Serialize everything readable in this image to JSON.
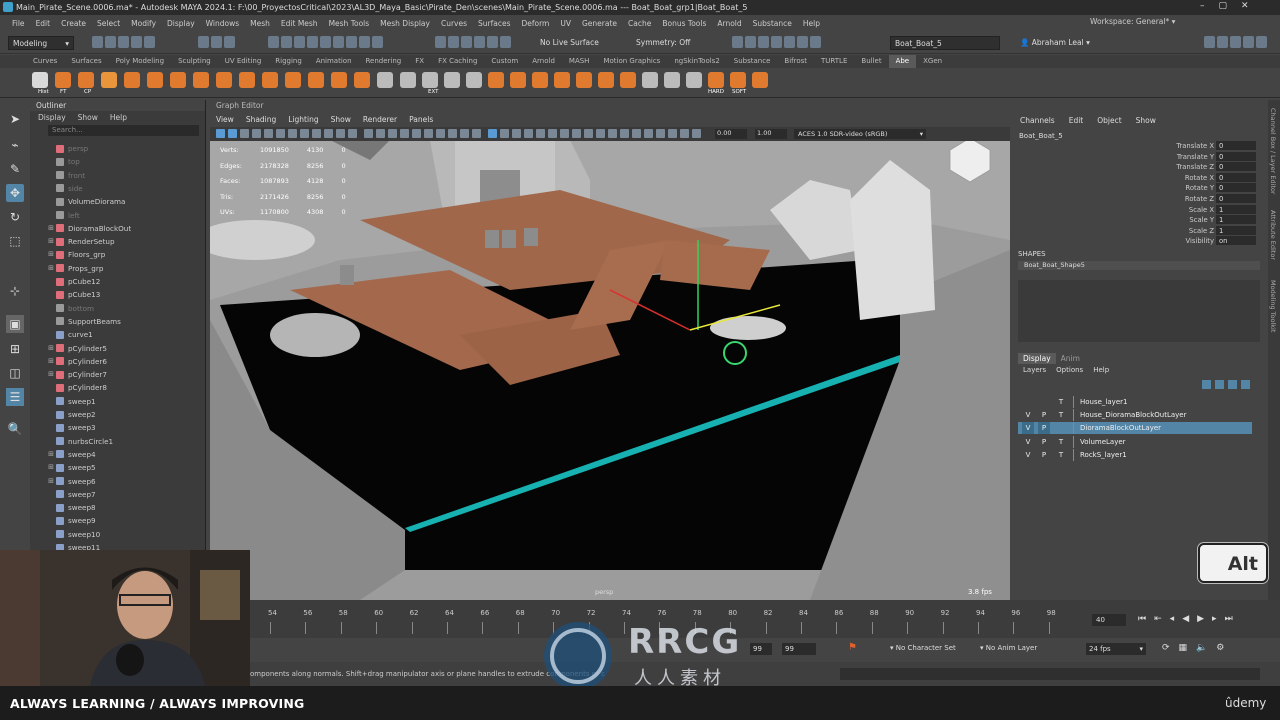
{
  "window": {
    "title": "Main_Pirate_Scene.0006.ma* - Autodesk MAYA 2024.1: F:\\00_ProyectosCritical\\2023\\AL3D_Maya_Basic\\Pirate_Den\\scenes\\Main_Pirate_Scene.0006.ma   ---   Boat_Boat_grp1|Boat_Boat_5"
  },
  "menu": [
    "File",
    "Edit",
    "Create",
    "Select",
    "Modify",
    "Display",
    "Windows",
    "Mesh",
    "Edit Mesh",
    "Mesh Tools",
    "Mesh Display",
    "Curves",
    "Surfaces",
    "Deform",
    "UV",
    "Generate",
    "Cache",
    "Bonus Tools",
    "Arnold",
    "Substance",
    "Help"
  ],
  "workspace": {
    "label": "Workspace:",
    "value": "General*"
  },
  "status": {
    "mode": "Modeling",
    "live_surface": "No Live Surface",
    "symmetry": "Symmetry: Off",
    "object_field": "Boat_Boat_5",
    "user": "Abraham Leal"
  },
  "shelf_tabs": [
    "Curves",
    "Surfaces",
    "Poly Modeling",
    "Sculpting",
    "UV Editing",
    "Rigging",
    "Animation",
    "Rendering",
    "FX",
    "FX Caching",
    "Custom",
    "Arnold",
    "MASH",
    "Motion Graphics",
    "ngSkinTools2",
    "Substance",
    "Bifrost",
    "TURTLE",
    "Bullet",
    "Abe",
    "XGen"
  ],
  "shelf_labels": {
    "hist": "Hist",
    "ft": "FT",
    "cp": "CP",
    "ext": "EXT",
    "hard": "HARD",
    "soft": "SOFT"
  },
  "outliner": {
    "title": "Outliner",
    "menu": [
      "Display",
      "Show",
      "Help"
    ],
    "search_placeholder": "Search...",
    "items": [
      {
        "name": "persp",
        "dim": true,
        "exp": ""
      },
      {
        "name": "top",
        "dim": true,
        "exp": ""
      },
      {
        "name": "front",
        "dim": true,
        "exp": ""
      },
      {
        "name": "side",
        "dim": true,
        "exp": ""
      },
      {
        "name": "VolumeDiorama",
        "dim": false,
        "exp": ""
      },
      {
        "name": "left",
        "dim": true,
        "exp": ""
      },
      {
        "name": "DioramaBlockOut",
        "dim": false,
        "exp": "+"
      },
      {
        "name": "RenderSetup",
        "dim": false,
        "exp": "+"
      },
      {
        "name": "Floors_grp",
        "dim": false,
        "exp": "+"
      },
      {
        "name": "Props_grp",
        "dim": false,
        "exp": "+"
      },
      {
        "name": "pCube12",
        "dim": false,
        "exp": ""
      },
      {
        "name": "pCube13",
        "dim": false,
        "exp": ""
      },
      {
        "name": "bottom",
        "dim": true,
        "exp": ""
      },
      {
        "name": "SupportBeams",
        "dim": false,
        "exp": ""
      },
      {
        "name": "curve1",
        "dim": false,
        "exp": ""
      },
      {
        "name": "pCylinder5",
        "dim": false,
        "exp": "+"
      },
      {
        "name": "pCylinder6",
        "dim": false,
        "exp": "+"
      },
      {
        "name": "pCylinder7",
        "dim": false,
        "exp": "+"
      },
      {
        "name": "pCylinder8",
        "dim": false,
        "exp": ""
      },
      {
        "name": "sweep1",
        "dim": false,
        "exp": ""
      },
      {
        "name": "sweep2",
        "dim": false,
        "exp": ""
      },
      {
        "name": "sweep3",
        "dim": false,
        "exp": ""
      },
      {
        "name": "nurbsCircle1",
        "dim": false,
        "exp": ""
      },
      {
        "name": "sweep4",
        "dim": false,
        "exp": "+"
      },
      {
        "name": "sweep5",
        "dim": false,
        "exp": "+"
      },
      {
        "name": "sweep6",
        "dim": false,
        "exp": "+"
      },
      {
        "name": "sweep7",
        "dim": false,
        "exp": ""
      },
      {
        "name": "sweep8",
        "dim": false,
        "exp": ""
      },
      {
        "name": "sweep9",
        "dim": false,
        "exp": ""
      },
      {
        "name": "sweep10",
        "dim": false,
        "exp": ""
      },
      {
        "name": "sweep11",
        "dim": false,
        "exp": ""
      }
    ]
  },
  "viewport": {
    "panel_title": "Graph Editor",
    "menu": [
      "View",
      "Shading",
      "Lighting",
      "Show",
      "Renderer",
      "Panels"
    ],
    "field1": "0.00",
    "field2": "1.00",
    "colorspace": "ACES 1.0 SDR-video (sRGB)",
    "camera": "persp",
    "fps": "3.8 fps",
    "stats": [
      {
        "label": "Verts:",
        "a": "1091850",
        "b": "4130",
        "c": "0"
      },
      {
        "label": "Edges:",
        "a": "2178328",
        "b": "8256",
        "c": "0"
      },
      {
        "label": "Faces:",
        "a": "1087893",
        "b": "4128",
        "c": "0"
      },
      {
        "label": "Tris:",
        "a": "2171426",
        "b": "8256",
        "c": "0"
      },
      {
        "label": "UVs:",
        "a": "1170800",
        "b": "4308",
        "c": "0"
      }
    ]
  },
  "channel_box": {
    "menu": [
      "Channels",
      "Edit",
      "Object",
      "Show"
    ],
    "object": "Boat_Boat_5",
    "attrs": [
      {
        "n": "Translate X",
        "v": "0"
      },
      {
        "n": "Translate Y",
        "v": "0"
      },
      {
        "n": "Translate Z",
        "v": "0"
      },
      {
        "n": "Rotate X",
        "v": "0"
      },
      {
        "n": "Rotate Y",
        "v": "0"
      },
      {
        "n": "Rotate Z",
        "v": "0"
      },
      {
        "n": "Scale X",
        "v": "1"
      },
      {
        "n": "Scale Y",
        "v": "1"
      },
      {
        "n": "Scale Z",
        "v": "1"
      },
      {
        "n": "Visibility",
        "v": "on"
      }
    ],
    "shapes_label": "SHAPES",
    "shape": "Boat_Boat_Shape5"
  },
  "layers": {
    "tabs": [
      "Display",
      "Anim"
    ],
    "menu": [
      "Layers",
      "Options",
      "Help"
    ],
    "items": [
      {
        "v": "",
        "p": "",
        "t": "T",
        "name": "House_layer1",
        "sel": false
      },
      {
        "v": "V",
        "p": "P",
        "t": "T",
        "name": "House_DioramaBlockOutLayer",
        "sel": false
      },
      {
        "v": "V",
        "p": "P",
        "t": "",
        "name": "DioramaBlockOutLayer",
        "sel": true
      },
      {
        "v": "V",
        "p": "P",
        "t": "T",
        "name": "VolumeLayer",
        "sel": false
      },
      {
        "v": "V",
        "p": "P",
        "t": "T",
        "name": "RockS_layer1",
        "sel": false
      }
    ]
  },
  "side_tabs": [
    "Channel Box / Layer Editor",
    "Attribute Editor",
    "Modeling Toolkit"
  ],
  "timeline": {
    "ticks": [
      "54",
      "56",
      "58",
      "60",
      "62",
      "64",
      "66",
      "68",
      "70",
      "72",
      "74",
      "76",
      "78",
      "80",
      "82",
      "84",
      "86",
      "88",
      "90",
      "92",
      "94",
      "96",
      "98"
    ],
    "current": "40",
    "range_a": "99",
    "range_b": "99",
    "char_set": "No Character Set",
    "anim_layer": "No Anim Layer",
    "fps": "24 fps"
  },
  "help_line": "omponents along normals. Shift+drag manipulator axis or plane handles to extrude components or c",
  "overlay": {
    "alt_key": "Alt",
    "slogan": "ALWAYS LEARNING  / ALWAYS IMPROVING",
    "watermark": "RRCG",
    "watermark_sub": "人人素材",
    "udemy": "ûdemy"
  }
}
